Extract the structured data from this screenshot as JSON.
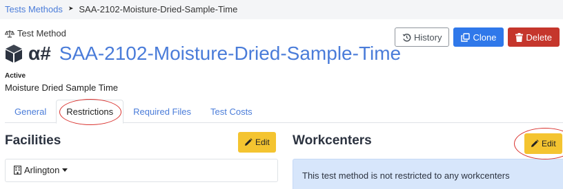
{
  "breadcrumb": {
    "root": "Tests Methods",
    "separator": "➤",
    "current": "SAA-2102-Moisture-Dried-Sample-Time"
  },
  "header": {
    "section_label": "Test Method",
    "title_prefix": "α#",
    "title": "SAA-2102-Moisture-Dried-Sample-Time",
    "status": "Active",
    "subtitle": "Moisture Dried Sample Time"
  },
  "actions": {
    "history": "History",
    "clone": "Clone",
    "delete": "Delete"
  },
  "tabs": [
    {
      "label": "General",
      "active": false
    },
    {
      "label": "Restrictions",
      "active": true
    },
    {
      "label": "Required Files",
      "active": false
    },
    {
      "label": "Test Costs",
      "active": false
    }
  ],
  "facilities": {
    "title": "Facilities",
    "edit_label": "Edit",
    "selected": "Arlington"
  },
  "workcenters": {
    "title": "Workcenters",
    "edit_label": "Edit",
    "info": "This test method is not restricted to any workcenters"
  },
  "colors": {
    "link": "#4a7cd9",
    "clone": "#2f78ea",
    "delete": "#c5362c",
    "edit": "#f4c430",
    "info_bg": "#d7e6fb",
    "annotation": "#d9302c"
  }
}
